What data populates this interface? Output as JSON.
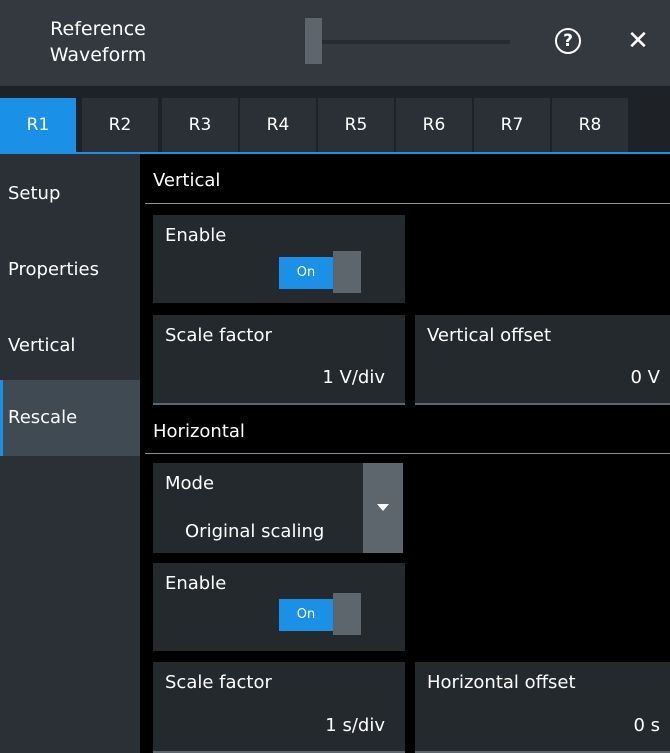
{
  "window": {
    "title_line1": "Reference",
    "title_line2": "Waveform",
    "help_icon": "?",
    "close_icon": "✕"
  },
  "tabs": [
    {
      "label": "R1",
      "active": true
    },
    {
      "label": "R2",
      "active": false
    },
    {
      "label": "R3",
      "active": false
    },
    {
      "label": "R4",
      "active": false
    },
    {
      "label": "R5",
      "active": false
    },
    {
      "label": "R6",
      "active": false
    },
    {
      "label": "R7",
      "active": false
    },
    {
      "label": "R8",
      "active": false
    }
  ],
  "sidebar": {
    "items": [
      {
        "label": "Setup",
        "active": false
      },
      {
        "label": "Properties",
        "active": false
      },
      {
        "label": "Vertical",
        "active": false
      },
      {
        "label": "Rescale",
        "active": true
      }
    ]
  },
  "vertical": {
    "section_title": "Vertical",
    "enable_label": "Enable",
    "enable_state": "On",
    "scale_label": "Scale factor",
    "scale_value": "1 V/div",
    "offset_label": "Vertical offset",
    "offset_value": "0 V"
  },
  "horizontal": {
    "section_title": "Horizontal",
    "mode_label": "Mode",
    "mode_value": "Original scaling",
    "enable_label": "Enable",
    "enable_state": "On",
    "scale_label": "Scale factor",
    "scale_value": "1 s/div",
    "offset_label": "Horizontal offset",
    "offset_value": "0 s"
  },
  "colors": {
    "accent": "#1a90e6",
    "panel": "#24292d",
    "sidebar": "#2a3035",
    "titlebar": "#33393f"
  }
}
